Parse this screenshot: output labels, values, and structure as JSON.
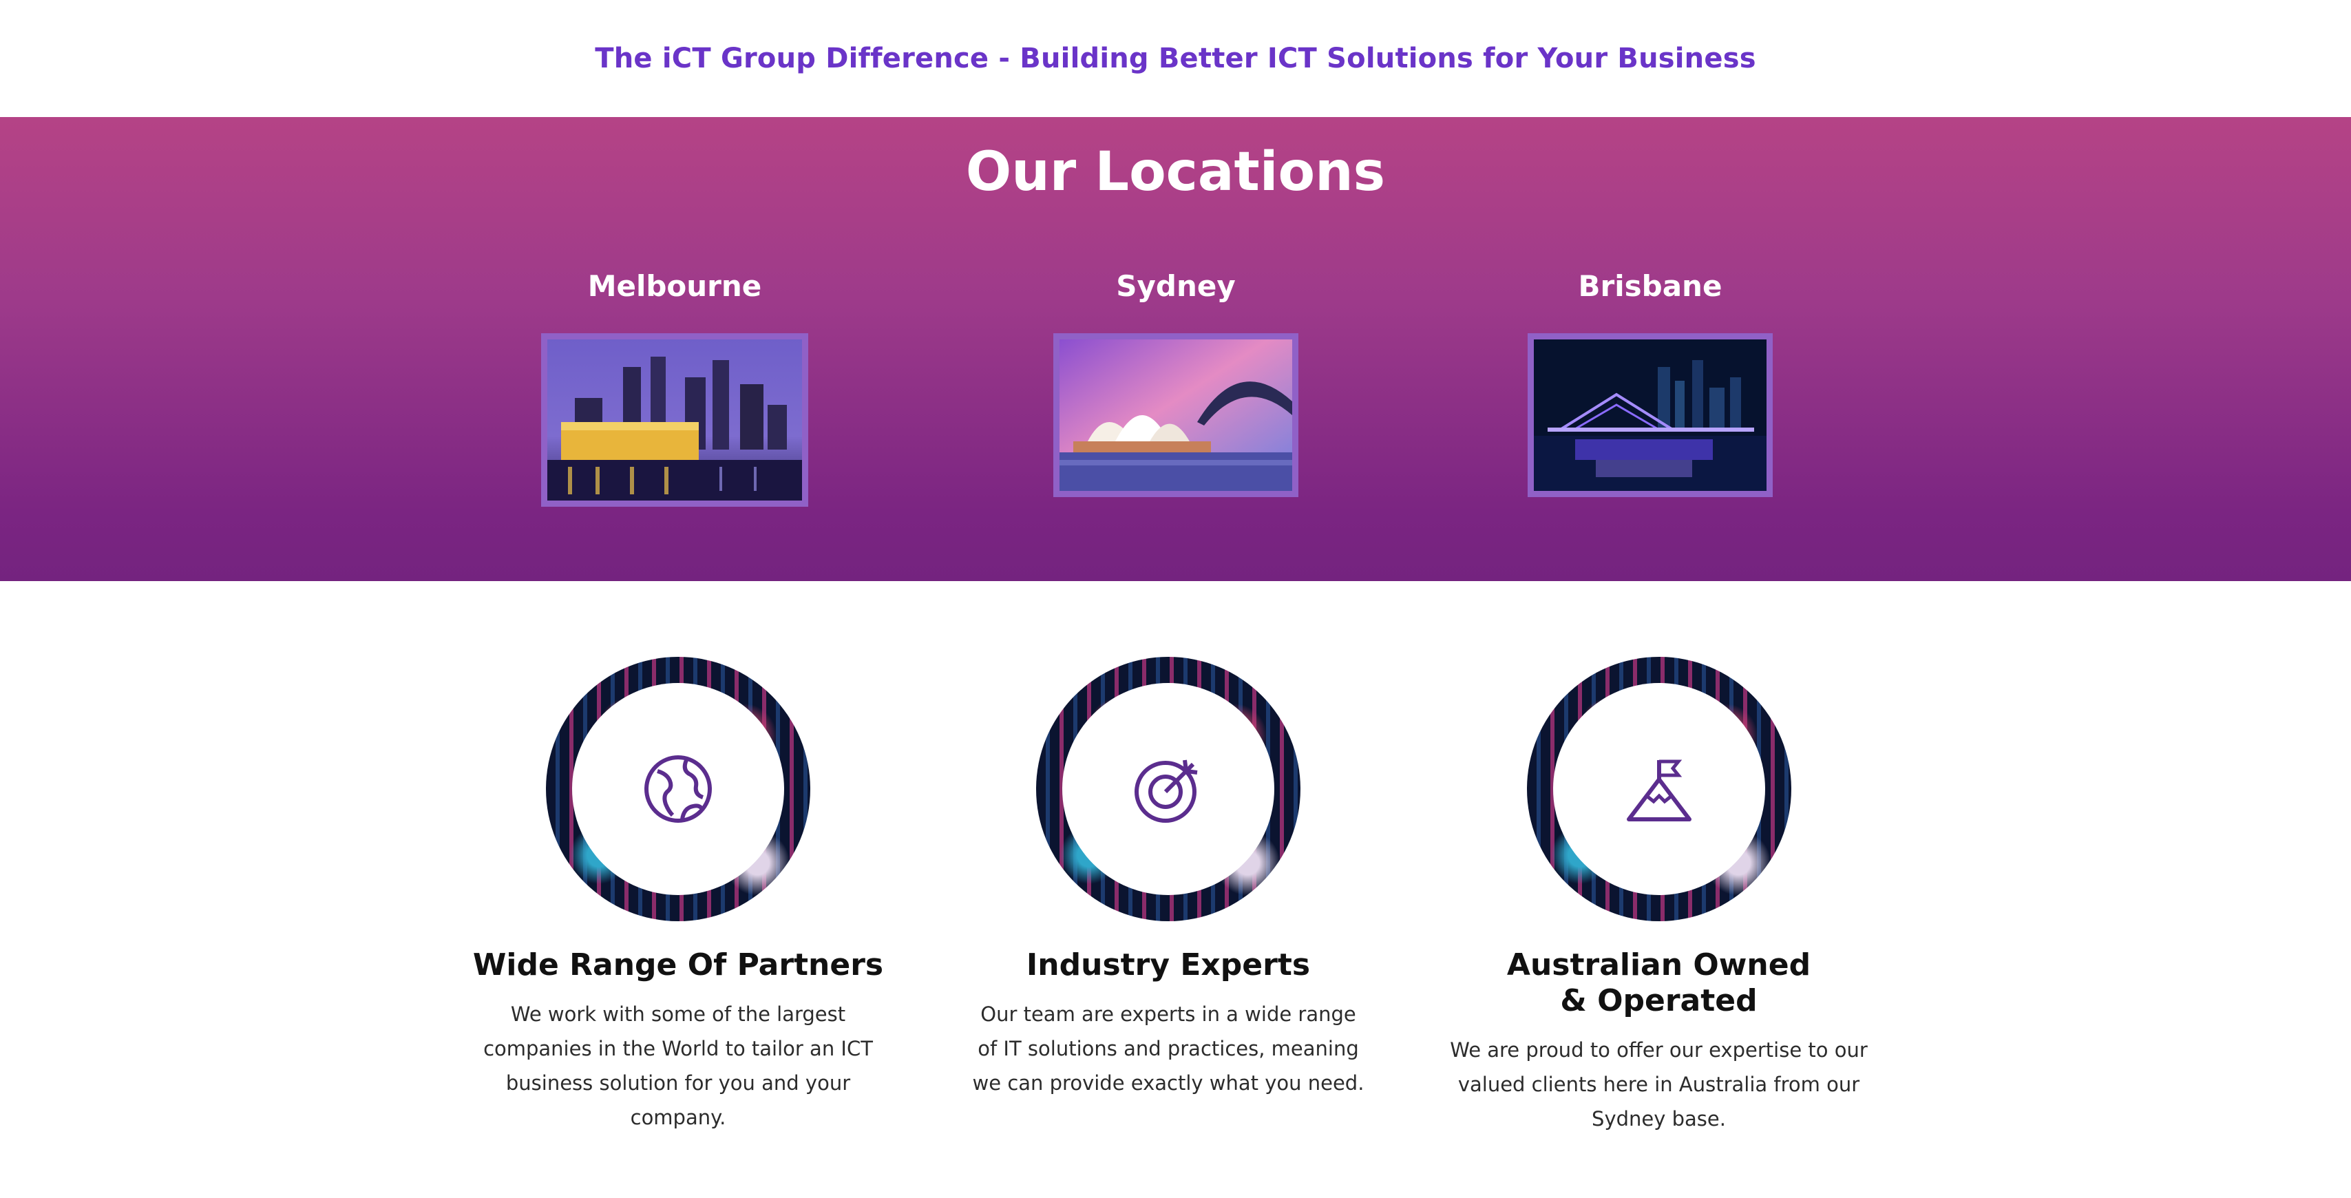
{
  "banner": {
    "title": "The iCT Group Difference - Building Better ICT Solutions for Your Business"
  },
  "locations": {
    "heading": "Our Locations",
    "items": [
      {
        "city": "Melbourne"
      },
      {
        "city": "Sydney"
      },
      {
        "city": "Brisbane"
      }
    ]
  },
  "features": [
    {
      "title": "Wide Range Of Partners",
      "text": "We work with some of the largest companies in the World to tailor an ICT business solution for you and your company.",
      "icon": "globe-icon"
    },
    {
      "title": "Industry Experts",
      "text": "Our team are experts in a wide range of IT solutions and practices, meaning we can provide exactly what you need.",
      "icon": "target-icon"
    },
    {
      "title": "Australian Owned & Operated",
      "text": "We are proud to offer our expertise to our valued clients here in Australia from our Sydney base.",
      "icon": "mountain-flag-icon"
    }
  ],
  "colors": {
    "accent": "#6a34c8",
    "gradient_top": "#b54386",
    "gradient_bottom": "#74237f",
    "photo_border": "#9061c7",
    "icon_stroke": "#5b2d8e"
  }
}
